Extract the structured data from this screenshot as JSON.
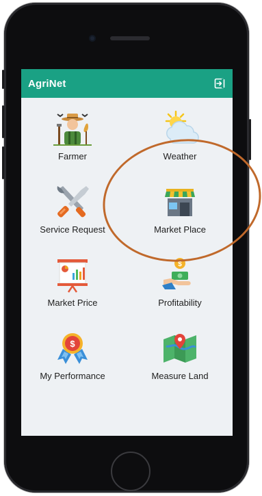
{
  "app": {
    "title": "AgriNet",
    "accent_color": "#1aa184",
    "logout_icon": "logout-icon"
  },
  "menu": [
    {
      "label": "Farmer",
      "icon": "farmer-icon"
    },
    {
      "label": "Weather",
      "icon": "weather-icon"
    },
    {
      "label": "Service Request",
      "icon": "tools-icon"
    },
    {
      "label": "Market Place",
      "icon": "market-stall-icon"
    },
    {
      "label": "Market Price",
      "icon": "price-chart-icon"
    },
    {
      "label": "Profitability",
      "icon": "money-hand-icon"
    },
    {
      "label": "My Performance",
      "icon": "medal-icon"
    },
    {
      "label": "Measure Land",
      "icon": "map-pin-icon"
    }
  ],
  "annotation": {
    "highlight": "Market Place",
    "color": "#c0692b"
  }
}
